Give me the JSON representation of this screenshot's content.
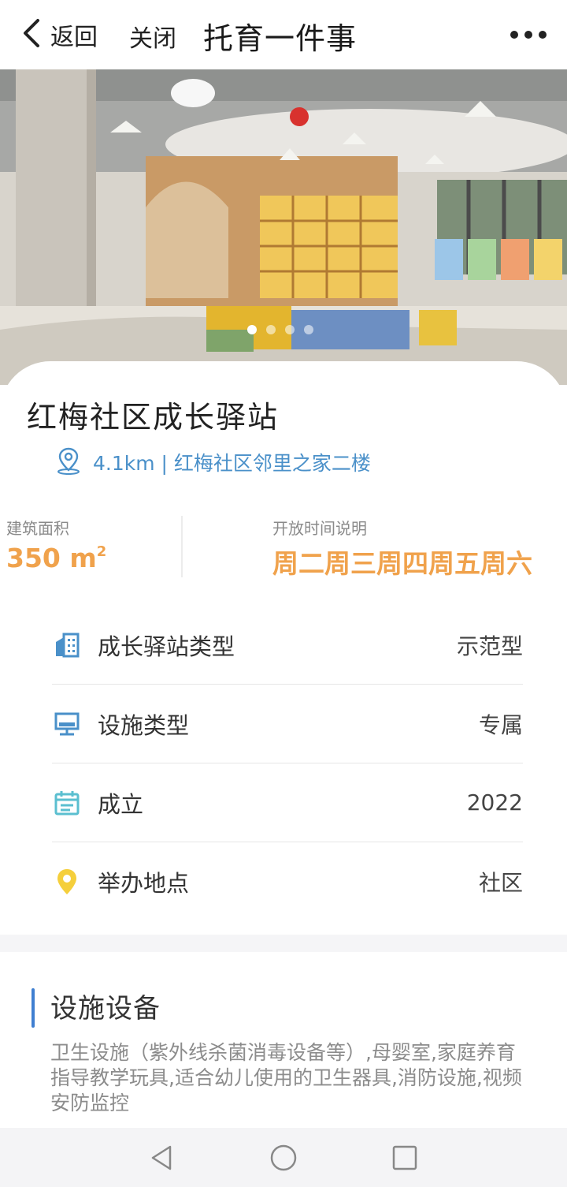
{
  "nav": {
    "back_label": "返回",
    "close_label": "关闭",
    "title": "托育一件事"
  },
  "hero": {
    "slide_count": 4,
    "active_slide": 1
  },
  "station": {
    "name": "红梅社区成长驿站",
    "location": "4.1km | 红梅社区邻里之家二楼"
  },
  "stats": {
    "area_label": "建筑面积",
    "area_value": "350 m",
    "area_unit_sup": "2",
    "hours_label": "开放时间说明",
    "hours_value": "周二周三周四周五周六"
  },
  "details": [
    {
      "icon": "building-icon",
      "label": "成长驿站类型",
      "value": "示范型"
    },
    {
      "icon": "monitor-icon",
      "label": "设施类型",
      "value": "专属"
    },
    {
      "icon": "calendar-icon",
      "label": "成立",
      "value": "2022"
    },
    {
      "icon": "location-pin-icon",
      "label": "举办地点",
      "value": "社区"
    }
  ],
  "facilities": {
    "title": "设施设备",
    "description": "卫生设施（紫外线杀菌消毒设备等）,母婴室,家庭养育指导教学玩具,适合幼儿使用的卫生器具,消防设施,视频安防监控"
  },
  "colors": {
    "accent_blue": "#4a90c9",
    "accent_orange": "#f0a24c",
    "section_bar": "#3f7fd1"
  }
}
